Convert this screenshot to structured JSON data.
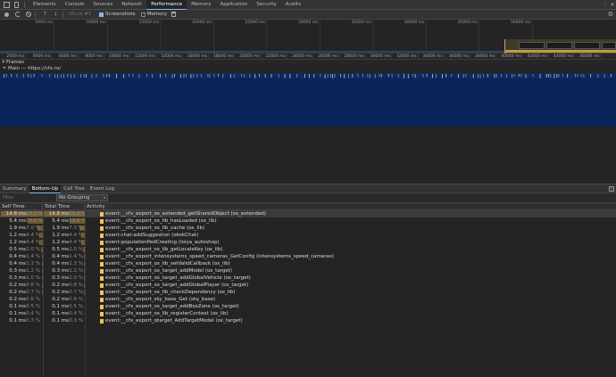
{
  "devtools_tabs": [
    {
      "label": "Elements",
      "active": false
    },
    {
      "label": "Console",
      "active": false
    },
    {
      "label": "Sources",
      "active": false
    },
    {
      "label": "Network",
      "active": false
    },
    {
      "label": "Performance",
      "active": true
    },
    {
      "label": "Memory",
      "active": false
    },
    {
      "label": "Application",
      "active": false
    },
    {
      "label": "Security",
      "active": false
    },
    {
      "label": "Audits",
      "active": false
    }
  ],
  "toolbar": {
    "profile_select": "cfx.re #1",
    "screenshots_label": "Screenshots",
    "screenshots_checked": true,
    "memory_label": "Memory",
    "memory_checked": false
  },
  "overview_ticks": [
    "5000 ms",
    "10000 ms",
    "15000 ms",
    "20000 ms",
    "25000 ms",
    "30000 ms",
    "35000 ms",
    "40000 ms",
    "45000 ms",
    "50000 ms"
  ],
  "ruler_ticks": [
    "2000 ms",
    "4000 ms",
    "6000 ms",
    "8000 ms",
    "10000 ms",
    "12000 ms",
    "14000 ms",
    "16000 ms",
    "18000 ms",
    "20000 ms",
    "22000 ms",
    "24000 ms",
    "26000 ms",
    "28000 ms",
    "30000 ms",
    "32000 ms",
    "34000 ms",
    "36000 ms",
    "38000 ms",
    "40000 ms",
    "42000 ms",
    "44000 ms",
    "46000 ms"
  ],
  "tracks": {
    "frames": "Frames",
    "main": "Main — https://cfx.re/"
  },
  "panel_tabs": [
    {
      "label": "Summary",
      "active": false
    },
    {
      "label": "Bottom-Up",
      "active": true
    },
    {
      "label": "Call Tree",
      "active": false
    },
    {
      "label": "Event Log",
      "active": false
    }
  ],
  "filter": {
    "placeholder": "Filter",
    "grouping": "No Grouping"
  },
  "columns": {
    "self": "Self Time",
    "total": "Total Time",
    "activity": "Activity"
  },
  "rows": [
    {
      "self_ms": "14.8 ms",
      "self_pct": "54.2 %",
      "self_frac": 0.542,
      "total_ms": "14.8 ms",
      "total_pct": "54.2 %",
      "total_frac": 0.542,
      "activity": "event:__cfx_export_ox_extended_getSharedObject (ox_extended)"
    },
    {
      "self_ms": "5.4 ms",
      "self_pct": "19.6 %",
      "self_frac": 0.196,
      "total_ms": "5.4 ms",
      "total_pct": "19.6 %",
      "total_frac": 0.196,
      "activity": "event:__cfx_export_ox_lib_hasLoaded (ox_lib)"
    },
    {
      "self_ms": "1.9 ms",
      "self_pct": "7.0 %",
      "self_frac": 0.07,
      "total_ms": "1.9 ms",
      "total_pct": "7.0 %",
      "total_frac": 0.07,
      "activity": "event:__cfx_export_ox_lib_cache (ox_lib)"
    },
    {
      "self_ms": "1.2 ms",
      "self_pct": "4.4 %",
      "self_frac": 0.044,
      "total_ms": "1.2 ms",
      "total_pct": "4.4 %",
      "total_frac": 0.044,
      "activity": "event:chat:addSuggestion (okokChat)"
    },
    {
      "self_ms": "1.2 ms",
      "self_pct": "4.4 %",
      "self_frac": 0.044,
      "total_ms": "1.2 ms",
      "total_pct": "4.4 %",
      "total_frac": 0.044,
      "activity": "event:populationPedCreating (loiya_autoshop)"
    },
    {
      "self_ms": "0.5 ms",
      "self_pct": "2.0 %",
      "self_frac": 0.02,
      "total_ms": "0.5 ms",
      "total_pct": "2.0 %",
      "total_frac": 0.02,
      "activity": "event:__cfx_export_ox_lib_getLocaleKey (ox_lib)"
    },
    {
      "self_ms": "0.4 ms",
      "self_pct": "1.4 %",
      "self_frac": 0.014,
      "total_ms": "0.4 ms",
      "total_pct": "1.4 %",
      "total_frac": 0.014,
      "activity": "event:__cfx_export_intensystems_speed_cameras_GetConfig (intensystems_speed_cameras)"
    },
    {
      "self_ms": "0.4 ms",
      "self_pct": "1.3 %",
      "self_frac": 0.013,
      "total_ms": "0.4 ms",
      "total_pct": "1.3 %",
      "total_frac": 0.013,
      "activity": "event:__cfx_export_ox_lib_setValidCallback (ox_lib)"
    },
    {
      "self_ms": "0.3 ms",
      "self_pct": "1.2 %",
      "self_frac": 0.012,
      "total_ms": "0.3 ms",
      "total_pct": "1.2 %",
      "total_frac": 0.012,
      "activity": "event:__cfx_export_ox_target_addModel (ox_target)"
    },
    {
      "self_ms": "0.3 ms",
      "self_pct": "1.0 %",
      "self_frac": 0.01,
      "total_ms": "0.3 ms",
      "total_pct": "1.0 %",
      "total_frac": 0.01,
      "activity": "event:__cfx_export_ox_target_addGlobalVehicle (ox_target)"
    },
    {
      "self_ms": "0.2 ms",
      "self_pct": "0.8 %",
      "self_frac": 0.008,
      "total_ms": "0.2 ms",
      "total_pct": "0.8 %",
      "total_frac": 0.008,
      "activity": "event:__cfx_export_ox_target_addGlobalPlayer (ox_target)"
    },
    {
      "self_ms": "0.2 ms",
      "self_pct": "0.7 %",
      "self_frac": 0.007,
      "total_ms": "0.2 ms",
      "total_pct": "0.7 %",
      "total_frac": 0.007,
      "activity": "event:__cfx_export_ox_lib_checkDependency (ox_lib)"
    },
    {
      "self_ms": "0.2 ms",
      "self_pct": "0.6 %",
      "self_frac": 0.006,
      "total_ms": "0.2 ms",
      "total_pct": "0.6 %",
      "total_frac": 0.006,
      "activity": "event:__cfx_export_sky_base_Get (sky_base)"
    },
    {
      "self_ms": "0.1 ms",
      "self_pct": "0.5 %",
      "self_frac": 0.005,
      "total_ms": "0.1 ms",
      "total_pct": "0.5 %",
      "total_frac": 0.005,
      "activity": "event:__cfx_export_ox_target_addBoxZone (ox_target)"
    },
    {
      "self_ms": "0.1 ms",
      "self_pct": "0.4 %",
      "self_frac": 0.004,
      "total_ms": "0.1 ms",
      "total_pct": "0.4 %",
      "total_frac": 0.004,
      "activity": "event:__cfx_export_ox_lib_registerContext (ox_lib)"
    },
    {
      "self_ms": "0.1 ms",
      "self_pct": "0.3 %",
      "self_frac": 0.003,
      "total_ms": "0.1 ms",
      "total_pct": "0.3 %",
      "total_frac": 0.003,
      "activity": "event:__cfx_export_qtarget_AddTargetModel (ox_target)"
    }
  ],
  "colors": {
    "accent": "#8ab4f8",
    "flame_main": "#0a2457",
    "activity_swatch": "#f2c35a",
    "time_bar": "#a8833c"
  }
}
